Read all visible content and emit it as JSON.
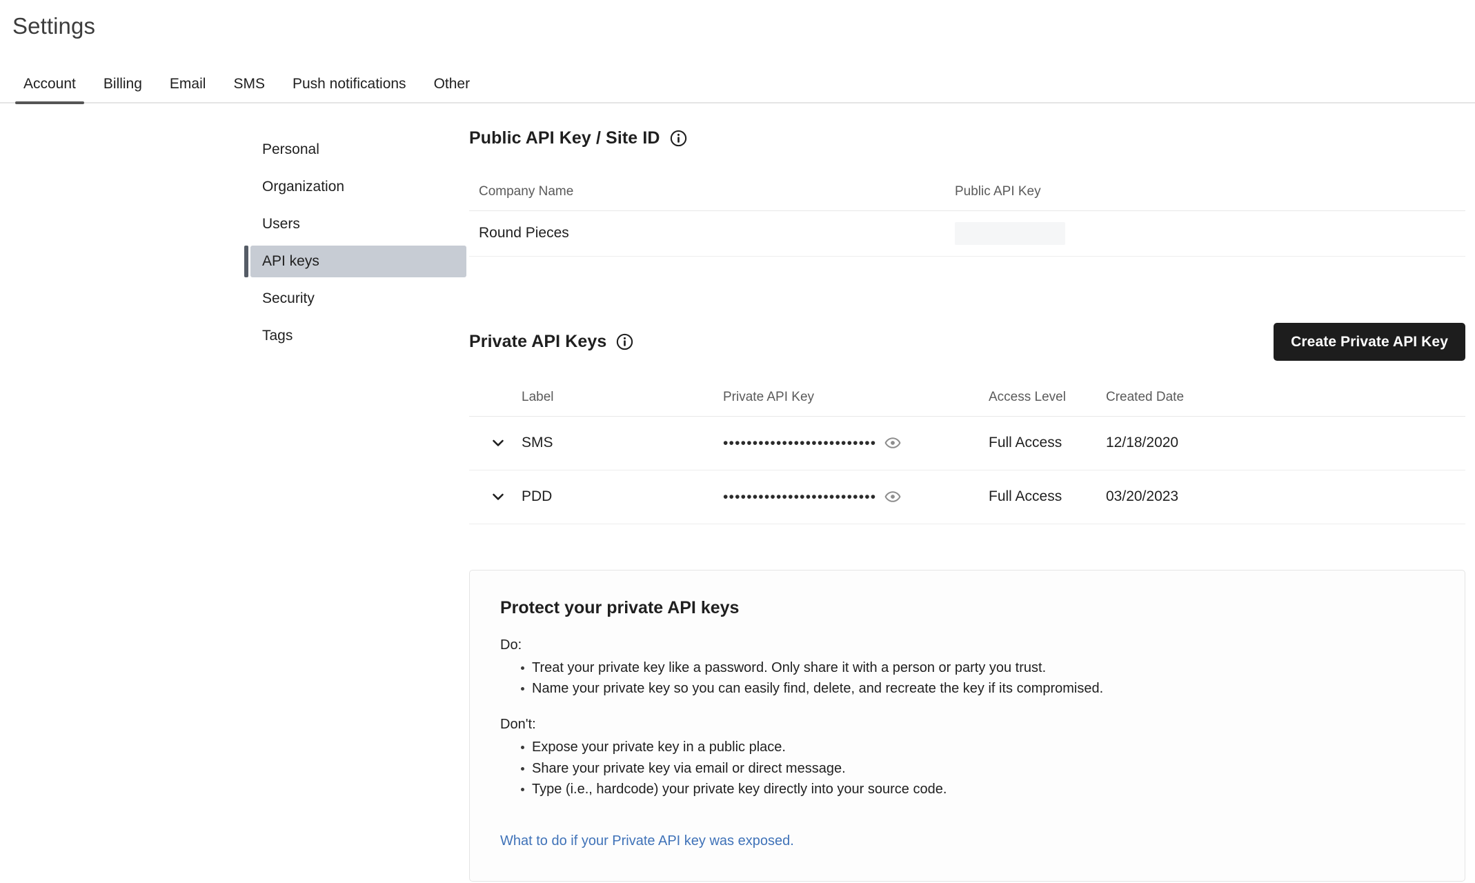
{
  "page": {
    "title": "Settings"
  },
  "tabs": [
    {
      "label": "Account",
      "active": true
    },
    {
      "label": "Billing",
      "active": false
    },
    {
      "label": "Email",
      "active": false
    },
    {
      "label": "SMS",
      "active": false
    },
    {
      "label": "Push notifications",
      "active": false
    },
    {
      "label": "Other",
      "active": false
    }
  ],
  "sidebar": {
    "items": [
      {
        "label": "Personal",
        "active": false
      },
      {
        "label": "Organization",
        "active": false
      },
      {
        "label": "Users",
        "active": false
      },
      {
        "label": "API keys",
        "active": true
      },
      {
        "label": "Security",
        "active": false
      },
      {
        "label": "Tags",
        "active": false
      }
    ]
  },
  "public_section": {
    "title": "Public API Key / Site ID",
    "info_icon": "info-icon",
    "columns": {
      "company": "Company Name",
      "public_key": "Public API Key"
    },
    "rows": [
      {
        "company": "Round Pieces",
        "public_key": ""
      }
    ]
  },
  "private_section": {
    "title": "Private API Keys",
    "info_icon": "info-icon",
    "create_button": "Create Private API Key",
    "columns": {
      "label": "Label",
      "private_key": "Private API Key",
      "access_level": "Access Level",
      "created_date": "Created Date"
    },
    "rows": [
      {
        "toggle_icon": "chevron-down-icon",
        "label": "SMS",
        "private_key_masked": "••••••••••••••••••••••••••",
        "reveal_icon": "eye-icon",
        "access_level": "Full Access",
        "created_date": "12/18/2020"
      },
      {
        "toggle_icon": "chevron-down-icon",
        "label": "PDD",
        "private_key_masked": "••••••••••••••••••••••••••",
        "reveal_icon": "eye-icon",
        "access_level": "Full Access",
        "created_date": "03/20/2023"
      }
    ]
  },
  "protect_card": {
    "title": "Protect your private API keys",
    "do_heading": "Do:",
    "do_items": [
      "Treat your private key like a password. Only share it with a person or party you trust.",
      "Name your private key so you can easily find, delete, and recreate the key if its compromised."
    ],
    "dont_heading": "Don't:",
    "dont_items": [
      "Expose your private key in a public place.",
      "Share your private key via email or direct message.",
      "Type (i.e., hardcode) your private key directly into your source code."
    ],
    "link": "What to do if your Private API key was exposed."
  },
  "colors": {
    "accent_button": "#1d1d1d",
    "sidebar_active_bg": "#c7ccd4",
    "sidebar_active_bar": "#555c66",
    "tab_underline": "#555555",
    "link": "#3f72b8",
    "redaction": "#f5f6f7"
  }
}
